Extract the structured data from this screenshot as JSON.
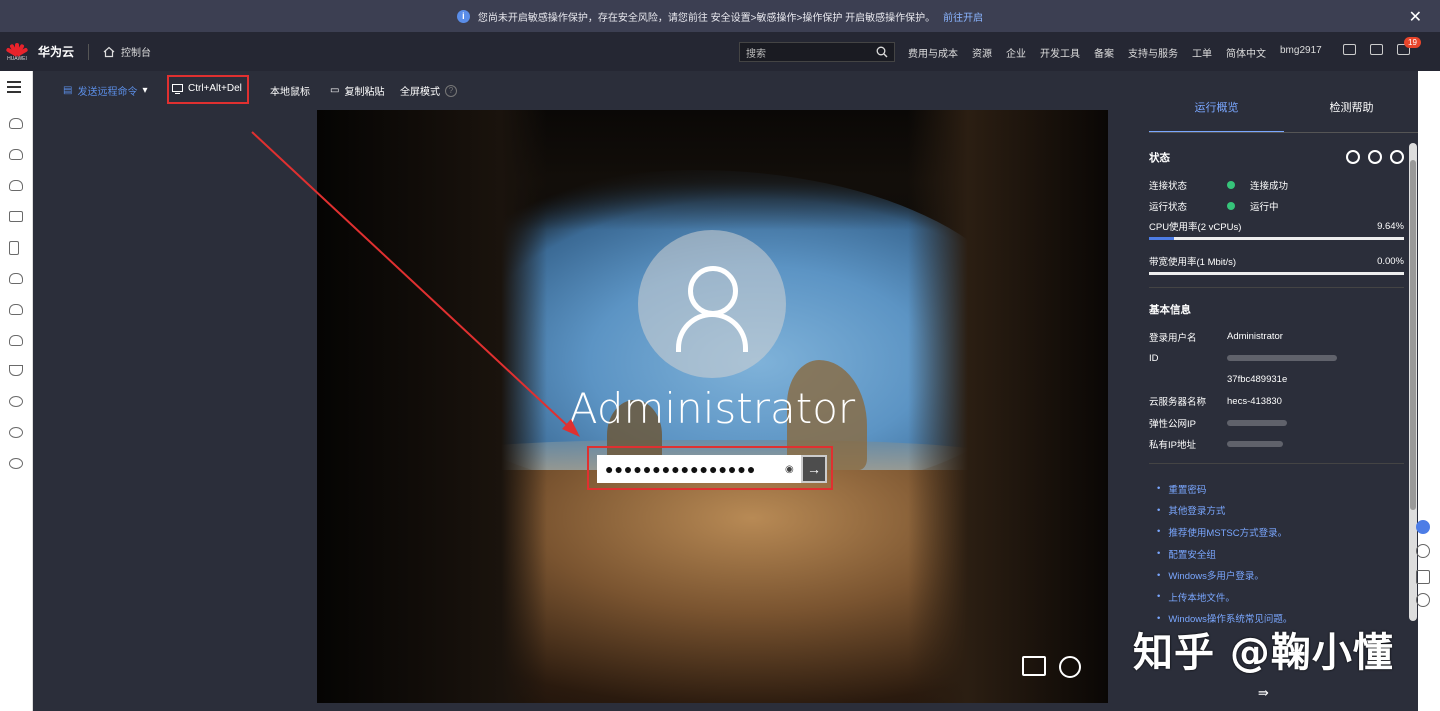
{
  "banner": {
    "message": "您尚未开启敏感操作保护，存在安全风险，请您前往 安全设置>敏感操作>操作保护 开启敏感操作保护。",
    "link": "前往开启",
    "close": "✕"
  },
  "topnav": {
    "logo_text": "HUAWEI",
    "brand": "华为云",
    "console": "控制台",
    "search_placeholder": "搜索",
    "links": [
      "费用与成本",
      "资源",
      "企业",
      "开发工具",
      "备案",
      "支持与服务",
      "工单",
      "简体中文",
      "bmg2917"
    ],
    "cart_badge": "19"
  },
  "toolbar": {
    "send_command": "发送远程命令",
    "ctrl_alt_del": "Ctrl+Alt+Del",
    "local_mouse": "本地鼠标",
    "copy_paste": "复制粘贴",
    "fullscreen": "全屏模式",
    "help": "?"
  },
  "remote": {
    "username": "Administrator",
    "password_masked": "●●●●●●●●●●●●●●●●",
    "submit": "→"
  },
  "panel": {
    "tabs": [
      "运行概览",
      "检测帮助"
    ],
    "status_title": "状态",
    "connection_label": "连接状态",
    "connection_value": "连接成功",
    "run_label": "运行状态",
    "run_value": "运行中",
    "cpu_label": "CPU使用率(2 vCPUs)",
    "cpu_value": "9.64%",
    "cpu_percent": 9.64,
    "bw_label": "带宽使用率(1 Mbit/s)",
    "bw_value": "0.00%",
    "bw_percent": 0,
    "basic_title": "基本信息",
    "login_user_label": "登录用户名",
    "login_user_value": "Administrator",
    "id_label": "ID",
    "id_value": "37fbc489931e",
    "server_name_label": "云服务器名称",
    "server_name_value": "hecs-413830",
    "eip_label": "弹性公网IP",
    "private_ip_label": "私有IP地址",
    "links": [
      "重置密码",
      "其他登录方式",
      "推荐使用MSTSC方式登录。",
      "配置安全组",
      "Windows多用户登录。",
      "上传本地文件。",
      "Windows操作系统常见问题。"
    ],
    "collapse": "⇛"
  },
  "watermark": "知乎 @鞠小懂"
}
